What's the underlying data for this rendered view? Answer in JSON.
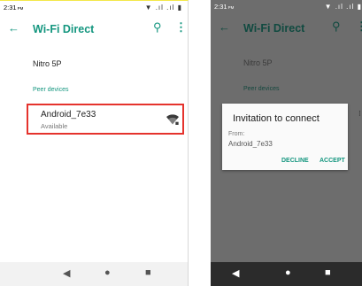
{
  "left_screen": {
    "status_time": "2:31",
    "status_ampm": "PM",
    "status_icons": "▼ .ıl .ıl ▮",
    "toolbar": {
      "back_icon": "←",
      "title": "Wi-Fi Direct",
      "search_icon": "⚲",
      "more_icon": "⋮"
    },
    "device_name": "Nitro 5P",
    "section_label": "Peer devices",
    "peer": {
      "name": "Android_7e33",
      "status": "Available",
      "icon": "wifi-signal-icon"
    },
    "nav": {
      "back": "◀",
      "home": "●",
      "recents": "■"
    }
  },
  "right_screen": {
    "status_time": "2:31",
    "status_ampm": "PM",
    "status_icons": "▼ .ıl .ıl ▮",
    "toolbar": {
      "back_icon": "←",
      "title": "Wi-Fi Direct",
      "search_icon": "⚲",
      "more_icon": "⋮"
    },
    "device_name": "Nitro 5P",
    "section_label": "Peer devices",
    "dialog": {
      "title": "Invitation to connect",
      "from_label": "From:",
      "from_value": "Android_7e33",
      "decline": "DECLINE",
      "accept": "ACCEPT"
    },
    "nav": {
      "back": "◀",
      "home": "●",
      "recents": "■"
    }
  },
  "colors": {
    "accent": "#14967f",
    "highlight_border": "#e5332d",
    "scrim": "#6d6d6d"
  }
}
